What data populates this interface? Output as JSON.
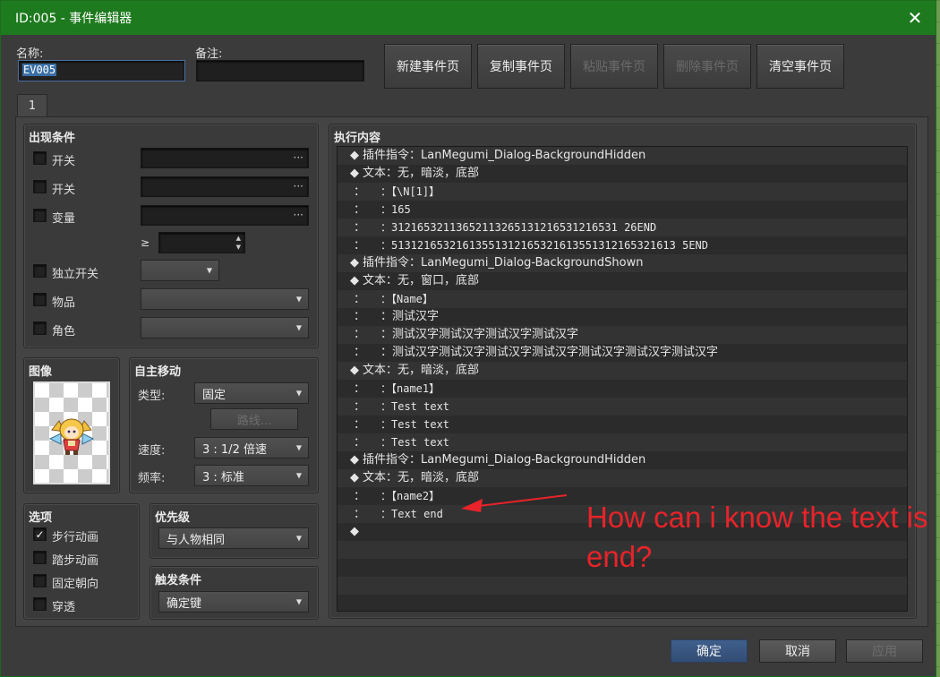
{
  "window": {
    "title": "ID:005 - 事件编辑器"
  },
  "fields": {
    "name_label": "名称:",
    "name_value": "EV005",
    "note_label": "备注:"
  },
  "toolbar": {
    "new_page": "新建事件页",
    "copy_page": "复制事件页",
    "paste_page": "粘贴事件页",
    "delete_page": "删除事件页",
    "clear_page": "清空事件页"
  },
  "tabs": [
    "1"
  ],
  "conditions": {
    "title": "出现条件",
    "switch1": "开关",
    "switch2": "开关",
    "variable": "变量",
    "gte": "≥",
    "self_switch": "独立开关",
    "item": "物品",
    "actor": "角色",
    "dots": "···"
  },
  "image": {
    "title": "图像"
  },
  "autonomous": {
    "title": "自主移动",
    "type_label": "类型:",
    "type_value": "固定",
    "route_button": "路线...",
    "speed_label": "速度:",
    "speed_value": "3 : 1/2 倍速",
    "freq_label": "频率:",
    "freq_value": "3 : 标准"
  },
  "options": {
    "title": "选项",
    "walking": "步行动画",
    "stepping": "踏步动画",
    "direction_fix": "固定朝向",
    "through": "穿透",
    "walking_checked": "✓"
  },
  "priority": {
    "title": "优先级",
    "value": "与人物相同"
  },
  "trigger": {
    "title": "触发条件",
    "value": "确定键"
  },
  "contents": {
    "title": "执行内容",
    "rows": [
      {
        "mark": "◆",
        "text": "插件指令：LanMegumi_Dialog-BackgroundHidden"
      },
      {
        "mark": "◆",
        "text": "文本：无，暗淡，底部"
      },
      {
        "mark": "：",
        "text": "：【\\N[1]】"
      },
      {
        "mark": "：",
        "text": "：165"
      },
      {
        "mark": "：",
        "text": "：31216532113652113265131216531216531 26END"
      },
      {
        "mark": "：",
        "text": "：51312165321613551312165321613551312165321613 5END"
      },
      {
        "mark": "◆",
        "text": "插件指令：LanMegumi_Dialog-BackgroundShown"
      },
      {
        "mark": "◆",
        "text": "文本：无，窗口，底部"
      },
      {
        "mark": "：",
        "text": "：【Name】"
      },
      {
        "mark": "：",
        "text": "：测试汉字"
      },
      {
        "mark": "：",
        "text": "：测试汉字测试汉字测试汉字测试汉字"
      },
      {
        "mark": "：",
        "text": "：测试汉字测试汉字测试汉字测试汉字测试汉字测试汉字测试汉字"
      },
      {
        "mark": "◆",
        "text": "文本：无，暗淡，底部"
      },
      {
        "mark": "：",
        "text": "：【name1】"
      },
      {
        "mark": "：",
        "text": "：Test text"
      },
      {
        "mark": "：",
        "text": "：Test text"
      },
      {
        "mark": "：",
        "text": "：Test text"
      },
      {
        "mark": "◆",
        "text": "插件指令：LanMegumi_Dialog-BackgroundHidden"
      },
      {
        "mark": "◆",
        "text": "文本：无，暗淡，底部"
      },
      {
        "mark": "：",
        "text": "：【name2】"
      },
      {
        "mark": "：",
        "text": "：Text end"
      },
      {
        "mark": "◆",
        "text": ""
      }
    ]
  },
  "buttons": {
    "ok": "确定",
    "cancel": "取消",
    "apply": "应用"
  },
  "annotation": {
    "text": "How can i know the text is end?"
  },
  "colors": {
    "titlebar": "#1e7a1e",
    "annotation": "#e8232a",
    "primary": "#3f5f8c"
  }
}
